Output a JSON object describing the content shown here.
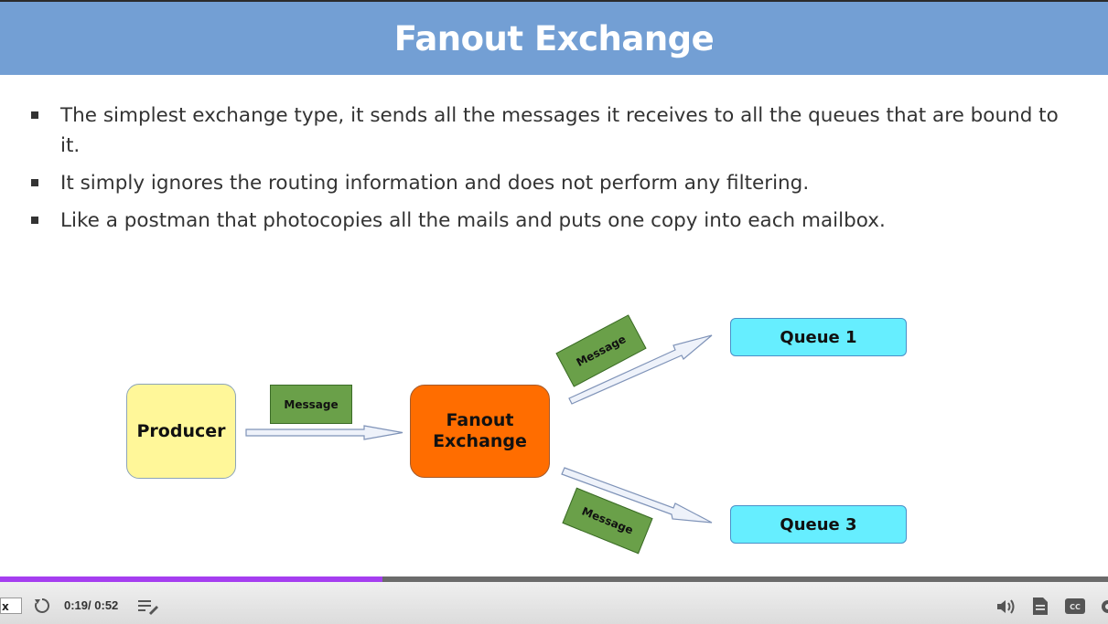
{
  "slide": {
    "title": "Fanout Exchange",
    "bullets": [
      "The simplest exchange type, it sends all the messages it receives to all the queues that are bound to it.",
      "It simply ignores the routing information and does not perform any filtering.",
      "Like a postman that photocopies all the mails and puts one copy into each mailbox."
    ]
  },
  "diagram": {
    "producer": "Producer",
    "exchange_line1": "Fanout",
    "exchange_line2": "Exchange",
    "queue1": "Queue 1",
    "queue3": "Queue 3",
    "message_label": "Message"
  },
  "player": {
    "speed": "x",
    "current_time": "0:19",
    "duration": "0:52",
    "progress": 0.345,
    "colors": {
      "progress": "#a53ef0",
      "header": "#739fd4"
    },
    "icons": [
      "replay-icon",
      "notes-icon",
      "volume-icon",
      "transcript-icon",
      "captions-icon",
      "settings-icon"
    ]
  }
}
